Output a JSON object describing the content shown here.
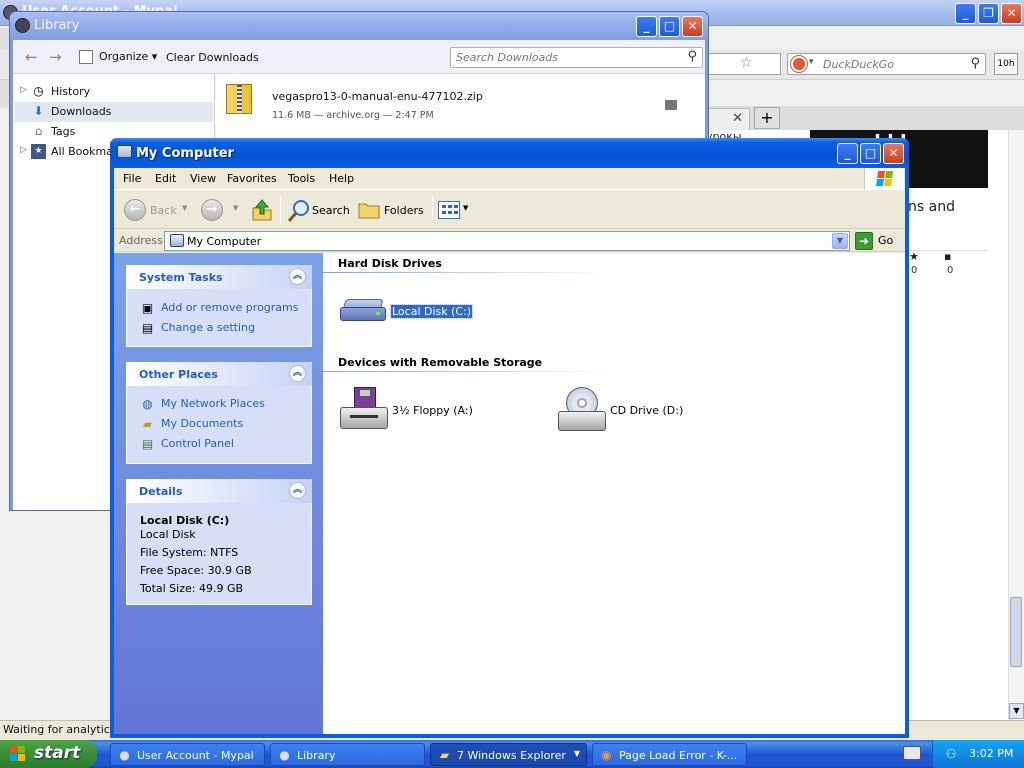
{
  "browser": {
    "window_title": "User Account - Mypal",
    "search_placeholder": "DuckDuckGo",
    "addon_label": "10h",
    "tab_text": "урокы",
    "card_text": "ns and",
    "stat_likes": "0",
    "stat_comments": "0",
    "status_text": "Waiting for analytics.a"
  },
  "library": {
    "title": "Library",
    "organize_label": "Organize",
    "clear_downloads_label": "Clear Downloads",
    "search_placeholder": "Search Downloads",
    "sidebar": [
      {
        "label": "History",
        "icon": "clock-icon"
      },
      {
        "label": "Downloads",
        "icon": "download-arrow-icon"
      },
      {
        "label": "Tags",
        "icon": "tag-icon"
      },
      {
        "label": "All Bookmarks",
        "icon": "bookmarks-icon"
      }
    ],
    "download": {
      "filename": "vegaspro13-0-manual-enu-477102.zip",
      "meta": "11.6 MB — archive.org — 2:47 PM"
    }
  },
  "mycomputer": {
    "title": "My Computer",
    "menu": [
      "File",
      "Edit",
      "View",
      "Favorites",
      "Tools",
      "Help"
    ],
    "toolbar": {
      "back": "Back",
      "search": "Search",
      "folders": "Folders"
    },
    "address": {
      "label": "Address",
      "value": "My Computer",
      "go": "Go"
    },
    "system_tasks": {
      "title": "System Tasks",
      "items": [
        "Add or remove programs",
        "Change a setting"
      ]
    },
    "other_places": {
      "title": "Other Places",
      "items": [
        "My Network Places",
        "My Documents",
        "Control Panel"
      ]
    },
    "details": {
      "title": "Details",
      "name": "Local Disk (C:)",
      "type": "Local Disk",
      "filesystem": "File System: NTFS",
      "free": "Free Space: 30.9 GB",
      "total": "Total Size: 49.9 GB"
    },
    "sections": {
      "hdd": "Hard Disk Drives",
      "removable": "Devices with Removable Storage"
    },
    "drives": {
      "local_disk": "Local Disk (C:)",
      "floppy": "3½ Floppy (A:)",
      "cd": "CD Drive (D:)"
    }
  },
  "taskbar": {
    "start": "start",
    "buttons": [
      {
        "label": "User Account - Mypal",
        "icon": "mypal-icon"
      },
      {
        "label": "Library",
        "icon": "mypal-icon"
      },
      {
        "label": "7 Windows Explorer",
        "icon": "folder-icon"
      },
      {
        "label": "Page Load Error - K-...",
        "icon": "browser-icon"
      }
    ],
    "clock": "3:02 PM"
  },
  "colors": {
    "xp_blue": "#0a5fe0",
    "task_link": "#215dc6",
    "selection": "#316ac5",
    "start_green": "#3c8f3a"
  }
}
